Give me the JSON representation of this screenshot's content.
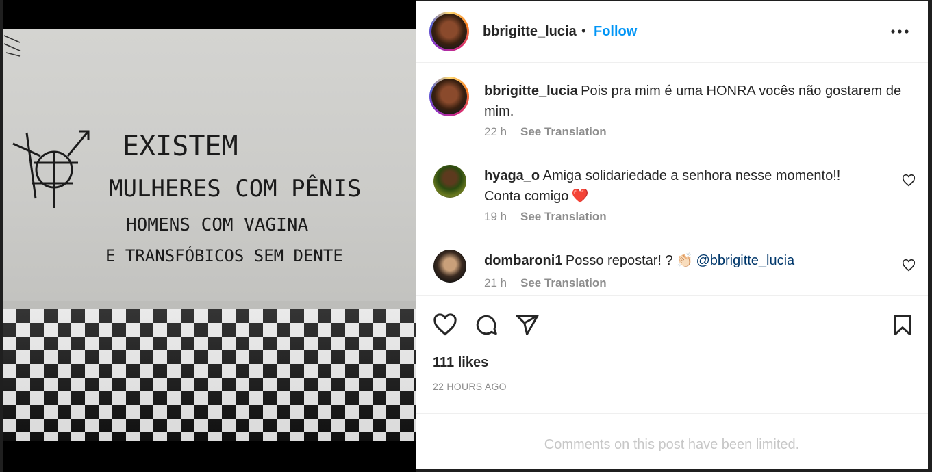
{
  "post": {
    "username": "bbrigitte_lucia",
    "follow_label": "Follow",
    "dot": "•",
    "more_icon": "more-options-icon"
  },
  "photo": {
    "lines": [
      "EXISTEM",
      "MULHERES COM PÊNIS",
      "HOMENS COM VAGINA",
      "E TRANSFÓBICOS SEM DENTE"
    ]
  },
  "caption": {
    "username": "bbrigitte_lucia",
    "text": "Pois pra mim é uma HONRA vocês não gostarem de mim.",
    "time": "22 h",
    "translate": "See Translation"
  },
  "comments": [
    {
      "username": "hyaga_o",
      "text_line1": "Amiga solidariedade a senhora nesse momento!!",
      "text_line2": "Conta comigo",
      "emoji": "❤️",
      "time": "19 h",
      "translate": "See Translation"
    },
    {
      "username": "dombaroni1",
      "text": "Posso repostar! ?",
      "emoji": "👏🏻",
      "mention": "@bbrigitte_lucia",
      "time": "21 h",
      "translate": "See Translation"
    }
  ],
  "engagement": {
    "likes": "111 likes",
    "posted": "22 HOURS AGO"
  },
  "footer": {
    "limited": "Comments on this post have been limited."
  },
  "colors": {
    "link": "#0095f6",
    "mention": "#00376b",
    "muted": "#8e8e8e",
    "text": "#262626"
  }
}
